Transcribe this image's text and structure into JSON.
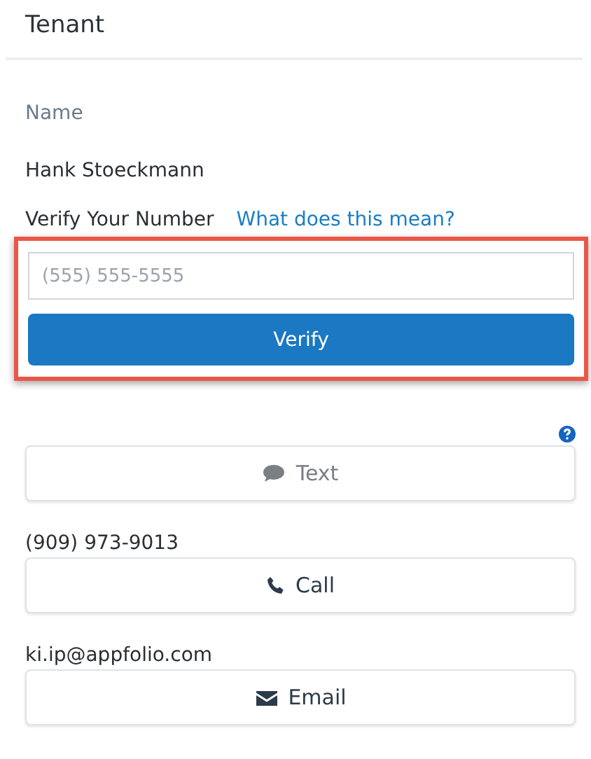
{
  "header": {
    "title": "Tenant"
  },
  "name_label": "Name",
  "name_value": "Hank Stoeckmann",
  "verify": {
    "label": "Verify Your Number",
    "help_link": "What does this mean?",
    "phone_placeholder": "(555) 555-5555",
    "button": "Verify",
    "highlighted": true
  },
  "contacts": [
    {
      "kind": "text",
      "button": "Text",
      "disabled": true
    },
    {
      "kind": "call",
      "detail": "(909) 973-9013",
      "button": "Call",
      "disabled": false
    },
    {
      "kind": "email",
      "detail": "ki.ip@appfolio.com",
      "button": "Email",
      "disabled": false
    }
  ]
}
